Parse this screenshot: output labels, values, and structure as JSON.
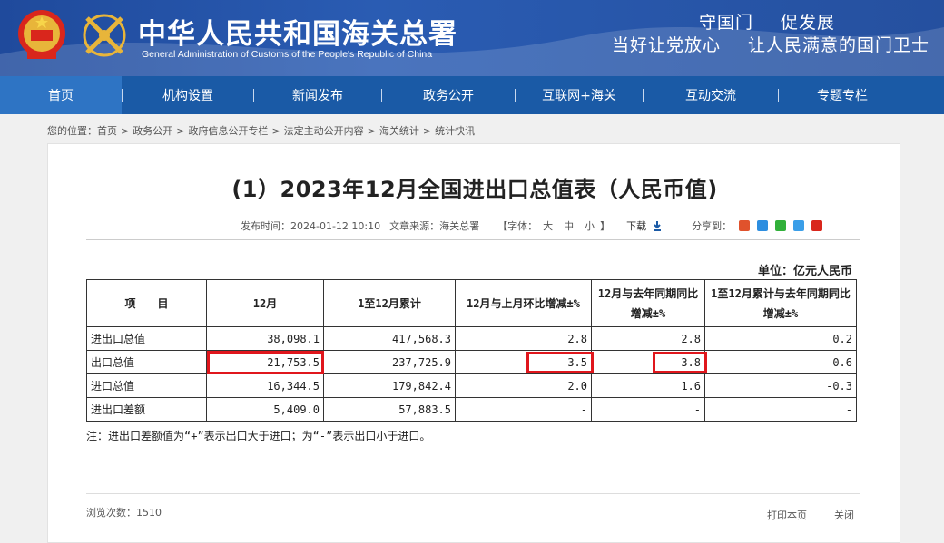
{
  "header": {
    "title_cn": "中华人民共和国海关总署",
    "title_en": "General Administration of Customs of the People's Republic of China",
    "slogan_line1": [
      "守国门",
      "促发展"
    ],
    "slogan_line2": [
      "当好让党放心",
      "让人民满意的国门卫士"
    ]
  },
  "nav": {
    "items": [
      "首页",
      "机构设置",
      "新闻发布",
      "政务公开",
      "互联网+海关",
      "互动交流",
      "专题专栏"
    ],
    "active_index": 0,
    "separator": "|"
  },
  "breadcrumb": {
    "prefix": "您的位置：",
    "items": [
      "首页",
      "政务公开",
      "政府信息公开专栏",
      "法定主动公开内容",
      "海关统计",
      "统计快讯"
    ],
    "arrow": ">"
  },
  "article": {
    "title": "(1）2023年12月全国进出口总值表（人民币值)",
    "publish_label": "发布时间：",
    "publish_time": "2024-01-12 10:10",
    "source_label": "文章来源：",
    "source": "海关总署",
    "font_label": "【字体：",
    "font_sizes": [
      "大",
      "中",
      "小"
    ],
    "font_close": "】",
    "download_label": "下载",
    "share_label": "分享到：",
    "share_icons": [
      "weibo-icon",
      "qq-zone-icon",
      "wechat-icon",
      "qq-friend-icon",
      "renren-icon"
    ]
  },
  "table": {
    "unit": "单位：亿元人民币",
    "headers": [
      "项　　目",
      "12月",
      "1至12月累计",
      "12月与上月环比增减±%",
      "12月与去年同期同比增减±%",
      "1至12月累计与去年同期同比增减±%"
    ],
    "rows": [
      {
        "label": "进出口总值",
        "dec": "38,098.1",
        "ytd": "417,568.3",
        "mom": "2.8",
        "yoy": "2.8",
        "ytd_yoy": "0.2"
      },
      {
        "label": "出口总值",
        "dec": "21,753.5",
        "ytd": "237,725.9",
        "mom": "3.5",
        "yoy": "3.8",
        "ytd_yoy": "0.6"
      },
      {
        "label": "进口总值",
        "dec": "16,344.5",
        "ytd": "179,842.4",
        "mom": "2.0",
        "yoy": "1.6",
        "ytd_yoy": "-0.3"
      },
      {
        "label": "进出口差额",
        "dec": "5,409.0",
        "ytd": "57,883.5",
        "mom": "-",
        "yoy": "-",
        "ytd_yoy": "-"
      }
    ],
    "note": "注：进出口差额值为“+”表示出口大于进口；为“-”表示出口小于进口。"
  },
  "footer": {
    "views_label": "浏览次数：",
    "views": "1510",
    "print": "打印本页",
    "close": "关闭"
  },
  "colors": {
    "header_bg": "#1f4a9c",
    "nav_bg": "#1a5aa6",
    "highlight": "#e0161c"
  }
}
